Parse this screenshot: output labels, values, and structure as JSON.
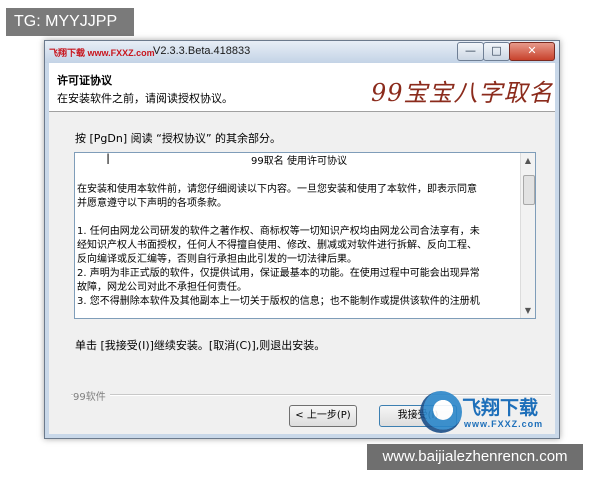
{
  "overlay": {
    "tag": "TG: MYYJJPP",
    "site_url": "www.baijialezhenrencn.com"
  },
  "window": {
    "logo_text": "飞翔下载 www.FXXZ.com",
    "title": "V2.3.3.Beta.418833",
    "controls": {
      "minimize": "—",
      "maximize": "□",
      "close": "✕"
    }
  },
  "header": {
    "title": "许可证协议",
    "subtitle": "在安装软件之前，请阅读授权协议。",
    "brand": "99宝宝八字取名"
  },
  "instruction": "按 [PgDn] 阅读 “授权协议” 的其余部分。",
  "license": {
    "lines": [
      "99取名 使用许可协议",
      "",
      "在安装和使用本软件前，请您仔细阅读以下内容。一旦您安装和使用了本软件，即表示同意",
      "并愿意遵守以下声明的各项条款。",
      "",
      "1. 任何由网龙公司研发的软件之著作权、商标权等一切知识产权均由网龙公司合法享有，未",
      "经知识产权人书面授权，任何人不得擅自使用、修改、删减或对软件进行拆解、反向工程、",
      "反向编译或反汇编等，否则自行承担由此引发的一切法律后果。",
      "2. 声明为非正式版的软件，仅提供试用，保证最基本的功能。在使用过程中可能会出现异常",
      "故障，网龙公司对此不承担任何责任。",
      "3. 您不得删除本软件及其他副本上一切关于版权的信息；也不能制作或提供该软件的注册机"
    ]
  },
  "accept_note": "单击 [我接受(I)]继续安装。[取消(C)],则退出安装。",
  "footer": {
    "brand": "99软件",
    "back_button": "< 上一步(P)",
    "agree_button": "我接受(I)"
  },
  "watermark": {
    "cn": "飞翔下载",
    "en": "www.FXXZ.com"
  }
}
